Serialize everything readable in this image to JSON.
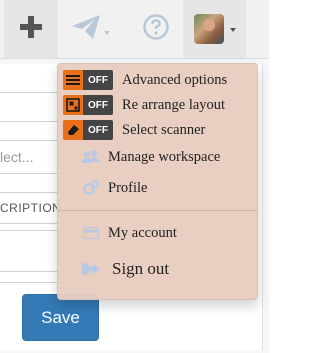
{
  "navbar": {
    "items": [
      {
        "icon": "plus-icon"
      },
      {
        "icon": "paper-plane-icon"
      },
      {
        "icon": "question-circle-icon"
      },
      {
        "icon": "avatar"
      }
    ]
  },
  "background": {
    "field_placeholder": "lect...",
    "column_header": "CRIPTION",
    "save_label": "Save"
  },
  "dropdown": {
    "toggles": [
      {
        "label": "Advanced options",
        "state": "OFF",
        "icon": "sliders-icon"
      },
      {
        "label": "Re arrange layout",
        "state": "OFF",
        "icon": "layout-icon"
      },
      {
        "label": "Select scanner",
        "state": "OFF",
        "icon": "eraser-icon"
      }
    ],
    "items": [
      {
        "label": "Manage workspace",
        "icon": "users-icon"
      },
      {
        "label": "Profile",
        "icon": "cogs-icon"
      },
      {
        "label": "My account",
        "icon": "credit-card-icon"
      },
      {
        "label": "Sign out",
        "icon": "sign-out-icon"
      }
    ]
  },
  "colors": {
    "toggle_accent": "#e8701a",
    "toggle_off_bg": "#444444",
    "primary_button": "#337ab7",
    "nav_icon": "#555555",
    "nav_icon_light": "#b9c8d6",
    "menu_icon": "#b8c8e6"
  }
}
